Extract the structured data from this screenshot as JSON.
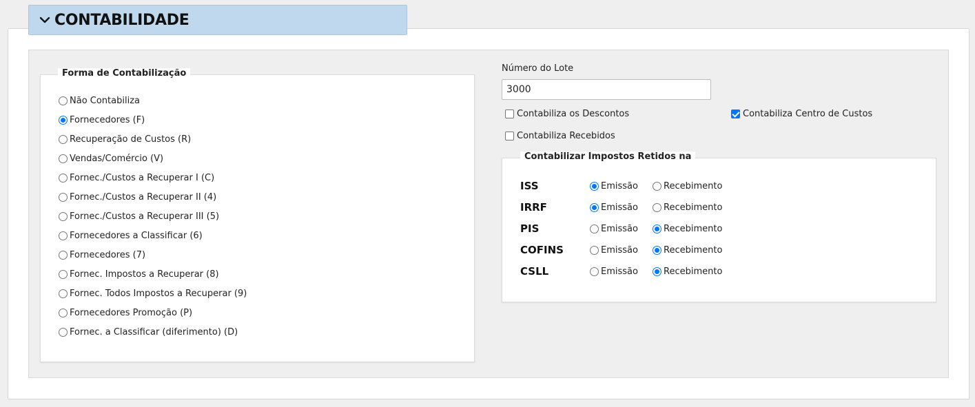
{
  "section": {
    "title": "CONTABILIDADE",
    "icon": "chevron-down-icon"
  },
  "forma": {
    "legend": "Forma de Contabilização",
    "selected_index": 1,
    "options": [
      "Não Contabiliza",
      "Fornecedores (F)",
      "Recuperação de Custos (R)",
      "Vendas/Comércio (V)",
      "Fornec./Custos a Recuperar I (C)",
      "Fornec./Custos a Recuperar II (4)",
      "Fornec./Custos a Recuperar III (5)",
      "Fornecedores a Classificar (6)",
      "Fornecedores (7)",
      "Fornec. Impostos a Recuperar (8)",
      "Fornec. Todos Impostos a Recuperar (9)",
      "Fornecedores Promoção (P)",
      "Fornec. a Classificar (diferimento) (D)"
    ]
  },
  "lote": {
    "label": "Número do Lote",
    "value": "3000"
  },
  "checks": {
    "descontos": {
      "label": "Contabiliza os Descontos",
      "checked": false
    },
    "centro_custos": {
      "label": "Contabiliza Centro de Custos",
      "checked": true
    },
    "recebidos": {
      "label": "Contabiliza Recebidos",
      "checked": false
    }
  },
  "impostos": {
    "legend": "Contabilizar Impostos Retidos na",
    "emissao_label": "Emissão",
    "recebimento_label": "Recebimento",
    "rows": [
      {
        "name": "ISS",
        "selected": "emissao"
      },
      {
        "name": "IRRF",
        "selected": "emissao"
      },
      {
        "name": "PIS",
        "selected": "recebimento"
      },
      {
        "name": "COFINS",
        "selected": "recebimento"
      },
      {
        "name": "CSLL",
        "selected": "recebimento"
      }
    ]
  },
  "colors": {
    "tab_bg": "#c0d8ee",
    "accent": "#0075ff",
    "panel_bg": "#efefef"
  }
}
